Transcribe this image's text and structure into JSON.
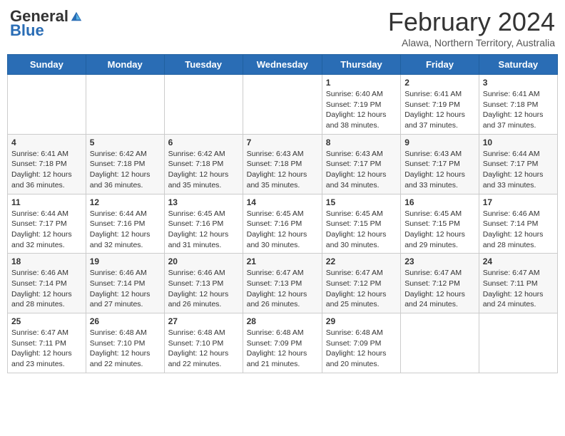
{
  "header": {
    "logo_general": "General",
    "logo_blue": "Blue",
    "month_title": "February 2024",
    "location": "Alawa, Northern Territory, Australia"
  },
  "weekdays": [
    "Sunday",
    "Monday",
    "Tuesday",
    "Wednesday",
    "Thursday",
    "Friday",
    "Saturday"
  ],
  "weeks": [
    [
      {
        "day": "",
        "info": ""
      },
      {
        "day": "",
        "info": ""
      },
      {
        "day": "",
        "info": ""
      },
      {
        "day": "",
        "info": ""
      },
      {
        "day": "1",
        "info": "Sunrise: 6:40 AM\nSunset: 7:19 PM\nDaylight: 12 hours and 38 minutes."
      },
      {
        "day": "2",
        "info": "Sunrise: 6:41 AM\nSunset: 7:19 PM\nDaylight: 12 hours and 37 minutes."
      },
      {
        "day": "3",
        "info": "Sunrise: 6:41 AM\nSunset: 7:18 PM\nDaylight: 12 hours and 37 minutes."
      }
    ],
    [
      {
        "day": "4",
        "info": "Sunrise: 6:41 AM\nSunset: 7:18 PM\nDaylight: 12 hours and 36 minutes."
      },
      {
        "day": "5",
        "info": "Sunrise: 6:42 AM\nSunset: 7:18 PM\nDaylight: 12 hours and 36 minutes."
      },
      {
        "day": "6",
        "info": "Sunrise: 6:42 AM\nSunset: 7:18 PM\nDaylight: 12 hours and 35 minutes."
      },
      {
        "day": "7",
        "info": "Sunrise: 6:43 AM\nSunset: 7:18 PM\nDaylight: 12 hours and 35 minutes."
      },
      {
        "day": "8",
        "info": "Sunrise: 6:43 AM\nSunset: 7:17 PM\nDaylight: 12 hours and 34 minutes."
      },
      {
        "day": "9",
        "info": "Sunrise: 6:43 AM\nSunset: 7:17 PM\nDaylight: 12 hours and 33 minutes."
      },
      {
        "day": "10",
        "info": "Sunrise: 6:44 AM\nSunset: 7:17 PM\nDaylight: 12 hours and 33 minutes."
      }
    ],
    [
      {
        "day": "11",
        "info": "Sunrise: 6:44 AM\nSunset: 7:17 PM\nDaylight: 12 hours and 32 minutes."
      },
      {
        "day": "12",
        "info": "Sunrise: 6:44 AM\nSunset: 7:16 PM\nDaylight: 12 hours and 32 minutes."
      },
      {
        "day": "13",
        "info": "Sunrise: 6:45 AM\nSunset: 7:16 PM\nDaylight: 12 hours and 31 minutes."
      },
      {
        "day": "14",
        "info": "Sunrise: 6:45 AM\nSunset: 7:16 PM\nDaylight: 12 hours and 30 minutes."
      },
      {
        "day": "15",
        "info": "Sunrise: 6:45 AM\nSunset: 7:15 PM\nDaylight: 12 hours and 30 minutes."
      },
      {
        "day": "16",
        "info": "Sunrise: 6:45 AM\nSunset: 7:15 PM\nDaylight: 12 hours and 29 minutes."
      },
      {
        "day": "17",
        "info": "Sunrise: 6:46 AM\nSunset: 7:14 PM\nDaylight: 12 hours and 28 minutes."
      }
    ],
    [
      {
        "day": "18",
        "info": "Sunrise: 6:46 AM\nSunset: 7:14 PM\nDaylight: 12 hours and 28 minutes."
      },
      {
        "day": "19",
        "info": "Sunrise: 6:46 AM\nSunset: 7:14 PM\nDaylight: 12 hours and 27 minutes."
      },
      {
        "day": "20",
        "info": "Sunrise: 6:46 AM\nSunset: 7:13 PM\nDaylight: 12 hours and 26 minutes."
      },
      {
        "day": "21",
        "info": "Sunrise: 6:47 AM\nSunset: 7:13 PM\nDaylight: 12 hours and 26 minutes."
      },
      {
        "day": "22",
        "info": "Sunrise: 6:47 AM\nSunset: 7:12 PM\nDaylight: 12 hours and 25 minutes."
      },
      {
        "day": "23",
        "info": "Sunrise: 6:47 AM\nSunset: 7:12 PM\nDaylight: 12 hours and 24 minutes."
      },
      {
        "day": "24",
        "info": "Sunrise: 6:47 AM\nSunset: 7:11 PM\nDaylight: 12 hours and 24 minutes."
      }
    ],
    [
      {
        "day": "25",
        "info": "Sunrise: 6:47 AM\nSunset: 7:11 PM\nDaylight: 12 hours and 23 minutes."
      },
      {
        "day": "26",
        "info": "Sunrise: 6:48 AM\nSunset: 7:10 PM\nDaylight: 12 hours and 22 minutes."
      },
      {
        "day": "27",
        "info": "Sunrise: 6:48 AM\nSunset: 7:10 PM\nDaylight: 12 hours and 22 minutes."
      },
      {
        "day": "28",
        "info": "Sunrise: 6:48 AM\nSunset: 7:09 PM\nDaylight: 12 hours and 21 minutes."
      },
      {
        "day": "29",
        "info": "Sunrise: 6:48 AM\nSunset: 7:09 PM\nDaylight: 12 hours and 20 minutes."
      },
      {
        "day": "",
        "info": ""
      },
      {
        "day": "",
        "info": ""
      }
    ]
  ]
}
